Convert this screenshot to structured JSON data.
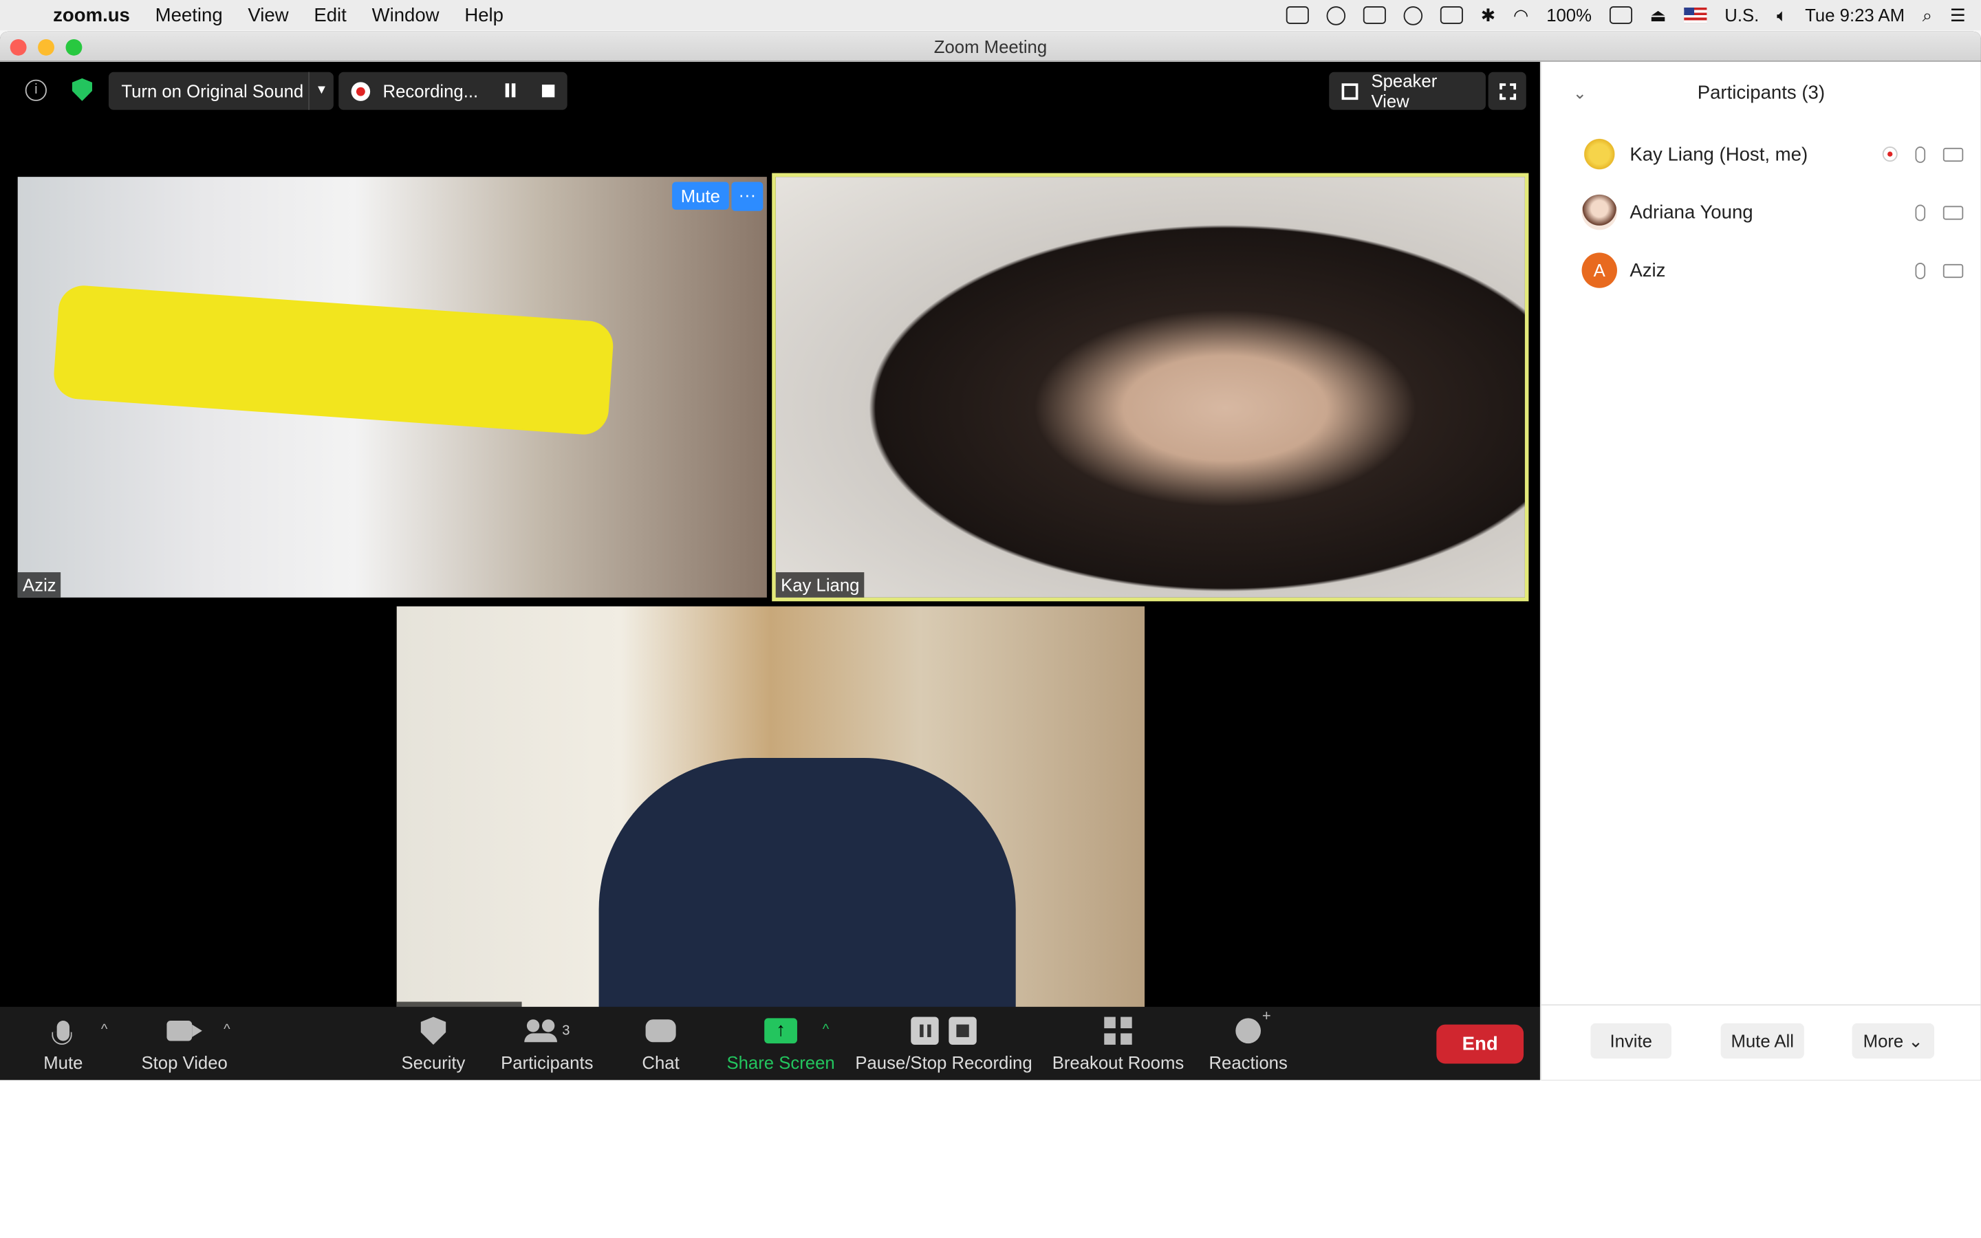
{
  "menubar": {
    "app": "zoom.us",
    "items": [
      "Meeting",
      "View",
      "Edit",
      "Window",
      "Help"
    ],
    "battery": "100%",
    "input": "U.S.",
    "clock": "Tue 9:23 AM"
  },
  "window": {
    "title": "Zoom Meeting"
  },
  "topbar": {
    "original_sound": "Turn on Original Sound",
    "recording": "Recording...",
    "speaker_view": "Speaker View"
  },
  "tiles": {
    "aziz": "Aziz",
    "kay": "Kay Liang",
    "adriana": "Adriana Young",
    "mute_badge": "Mute",
    "more_badge": "···"
  },
  "toolbar": {
    "mute": "Mute",
    "stop_video": "Stop Video",
    "security": "Security",
    "participants": "Participants",
    "participants_count": "3",
    "chat": "Chat",
    "share": "Share Screen",
    "recording": "Pause/Stop Recording",
    "breakout": "Breakout Rooms",
    "reactions": "Reactions",
    "end": "End"
  },
  "panel": {
    "title": "Participants (3)",
    "participants": [
      {
        "name": "Kay Liang (Host, me)",
        "avatar": "star-avatar"
      },
      {
        "name": "Adriana Young",
        "avatar": "photo-avatar"
      },
      {
        "name": "Aziz",
        "avatar": "A"
      }
    ],
    "invite": "Invite",
    "mute_all": "Mute All",
    "more": "More"
  },
  "colors": {
    "accent": "#2d8cff",
    "end": "#d0262f",
    "share": "#23c55e",
    "speaker_border": "#e3e97a"
  }
}
